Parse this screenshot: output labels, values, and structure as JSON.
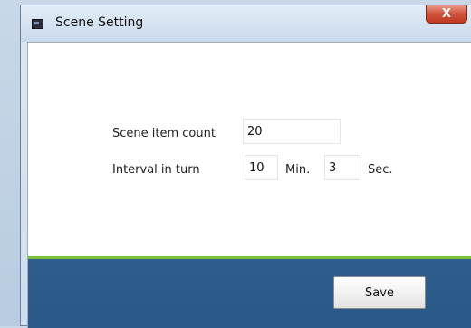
{
  "window": {
    "title": "Scene Setting",
    "close_label": "X"
  },
  "form": {
    "scene_item_count_label": "Scene item count",
    "scene_item_count_value": "20",
    "interval_label": "Interval in turn",
    "interval_min_value": "10",
    "min_unit": "Min.",
    "interval_sec_value": "3",
    "sec_unit": "Sec."
  },
  "footer": {
    "save_label": "Save"
  },
  "colors": {
    "accent_green": "#7cbf37",
    "footer_blue": "#2f5d8c",
    "close_red": "#c03a22"
  },
  "icons": {
    "app_icon": "window-app-icon",
    "close_icon": "close-icon"
  }
}
